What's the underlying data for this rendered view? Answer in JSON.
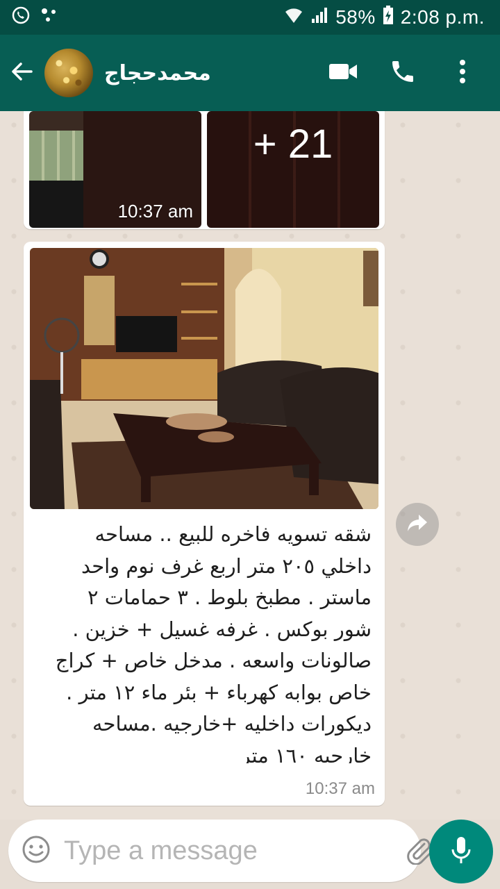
{
  "status_bar": {
    "battery": "58%",
    "time": "2:08 p.m."
  },
  "header": {
    "contact_name": "محمدحجاج"
  },
  "messages": {
    "album": {
      "more_count": "+ 21",
      "time": "10:37 am"
    },
    "listing": {
      "caption": "شقه تسويه فاخره للبيع .. مساحه داخلي ٢٠٥ متر اربع غرف نوم واحد ماستر . مطبخ بلوط . ٣ حمامات ٢ شور بوكس . غرفه غسيل + خزين . صالونات واسعه . مدخل خاص + كراج خاص بوابه كهرباء + بئر ماء ١٢ متر . ديكورات داخليه +خارجيه .مساحه خارجيه ١٦٠ متر",
      "time": "10:37 am"
    }
  },
  "input": {
    "placeholder": "Type a message"
  },
  "colors": {
    "header": "#075e54",
    "status_bar": "#054d44",
    "mic_button": "#00897b",
    "chat_background": "#e9e0d7"
  },
  "icons": [
    "back-arrow-icon",
    "video-call-icon",
    "phone-icon",
    "more-vert-icon",
    "forward-icon",
    "emoji-icon",
    "attach-icon",
    "camera-icon",
    "mic-icon"
  ]
}
